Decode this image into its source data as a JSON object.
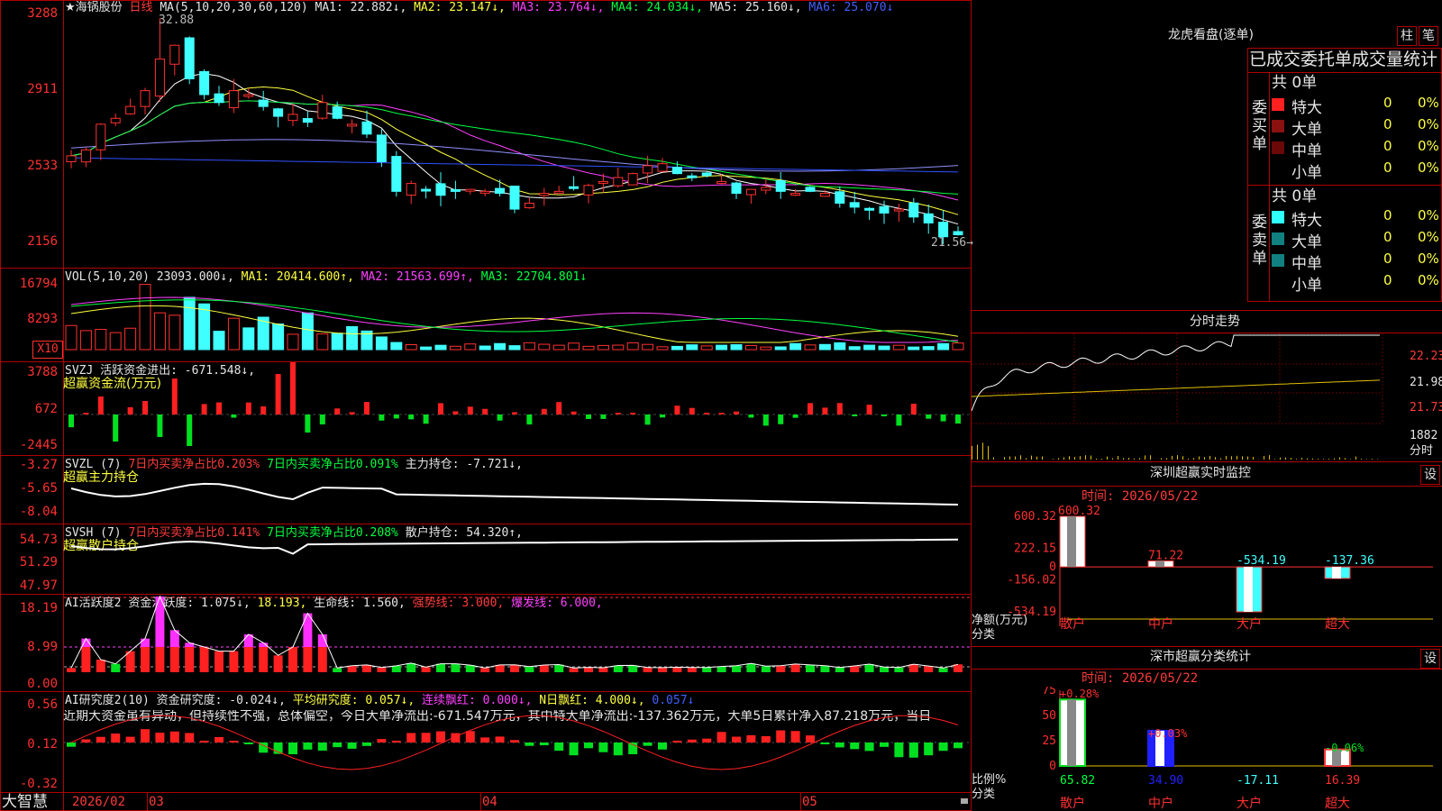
{
  "stock": {
    "name": "★海锅股份",
    "period": "日线",
    "ma_title": "MA(5,10,20,30,60,120)",
    "ma1": "MA1: 22.882↓,",
    "ma2": "MA2: 23.147↓,",
    "ma3": "MA3: 23.764↓,",
    "ma4": "MA4: 24.034↓,",
    "ma5": "MA5: 25.160↓,",
    "ma6": "MA6: 25.070↓",
    "high_mark": "32.88",
    "low_mark": "21.56→"
  },
  "price_axis": [
    "3288",
    "2911",
    "2533",
    "2156"
  ],
  "vol": {
    "title": "VOL(5,10,20)",
    "val": "23093.000↓,",
    "ma1": "MA1: 20414.600↑,",
    "ma2": "MA2: 21563.699↑,",
    "ma3": "MA3: 22704.801↓",
    "axis": [
      "16794",
      "8293"
    ],
    "unit": "X10"
  },
  "svzj": {
    "title": "SVZJ  活跃资金进出: -671.548↓,",
    "sub": "超赢资金流(万元)",
    "axis": [
      "3788",
      "672",
      "-2445"
    ]
  },
  "svzl": {
    "title": "SVZL (7)",
    "a": "7日内买卖净占比0.203%",
    "b": "7日内买卖净占比0.091%",
    "c": "主力持仓: -7.721↓,",
    "sub": "超赢主力持仓",
    "axis": [
      "-3.27",
      "-5.65",
      "-8.04"
    ]
  },
  "svsh": {
    "title": "SVSH (7)",
    "a": "7日内买卖净占比0.141%",
    "b": "7日内买卖净占比0.208%",
    "c": "散户持仓: 54.320↑,",
    "sub": "超赢散户持仓",
    "axis": [
      "54.73",
      "51.29",
      "47.97"
    ]
  },
  "ai1": {
    "title": "AI活跃度2",
    "a": "资金活跃度: 1.075↓,",
    "b": "18.193,",
    "c": "生命线: 1.560,",
    "d": "强势线: 3.000,",
    "e": "爆发线: 6.000,",
    "axis": [
      "18.19",
      "8.99",
      "0.00"
    ]
  },
  "ai2": {
    "title": "AI研究度2(10)",
    "a": "资金研究度: -0.024↓,",
    "b": "平均研究度: 0.057↓,",
    "c": "连续飘红: 0.000↓,",
    "d": "N日飘红: 4.000↓,",
    "e": "0.057↓",
    "axis": [
      "0.56",
      "0.12",
      "-0.32"
    ],
    "comment": "近期大资金虽有异动，但持续性不强，总体偏空，今日大单净流出:-671.547万元，其中特大单净流出:-137.362万元，大单5日累计净入87.218万元，当日"
  },
  "bottom_axis": {
    "brand": "大智慧",
    "labels": [
      "2026/02",
      "03",
      "04",
      "05"
    ]
  },
  "right": {
    "lhb_title": "龙虎看盘(逐单)",
    "btn_zhu": "柱",
    "btn_bi": "笔",
    "stats_title": "已成交委托单成交量统计",
    "buy_label": "委买单",
    "sell_label": "委卖单",
    "buy_total": "共 0单",
    "sell_total": "共 0单",
    "rows": [
      {
        "name": "特大",
        "val": "0",
        "pct": "0%"
      },
      {
        "name": "大单",
        "val": "0",
        "pct": "0%"
      },
      {
        "name": "中单",
        "val": "0",
        "pct": "0%"
      },
      {
        "name": "小单",
        "val": "0",
        "pct": "0%"
      }
    ],
    "fenshi_title": "分时走势",
    "fenshi_axis": [
      "22.23",
      "21.98",
      "21.73"
    ],
    "fenshi_vol": "1882",
    "fenshi_unit": "分时",
    "sz_title": "深圳超赢实时监控",
    "sz_btn": "设",
    "sz_time": "时间: 2026/05/22",
    "sz_axis": [
      "600.32",
      "222.15",
      "0",
      "-156.02",
      "-534.19"
    ],
    "sz_vals": [
      "600.32",
      "71.22",
      "-534.19",
      "-137.36"
    ],
    "sz_ylabel": "净额(万元)",
    "sz_xlabel": "分类",
    "cats": [
      "散户",
      "中户",
      "大户",
      "超大"
    ],
    "sm_title": "深市超赢分类统计",
    "sm_btn": "设",
    "sm_time": "时间: 2026/05/22",
    "sm_axis": [
      "75",
      "50",
      "25",
      "0"
    ],
    "sm_pcts": [
      "+0.28%",
      "+0.03%",
      "-0.06%"
    ],
    "sm_vals": [
      "65.82",
      "34.90",
      "-17.11",
      "16.39"
    ],
    "sm_ylabel": "比例%",
    "sm_xlabel": "分类"
  },
  "chart_data": {
    "type": "bar",
    "title": "深圳超赢实时监控",
    "categories": [
      "散户",
      "中户",
      "大户",
      "超大"
    ],
    "values": [
      600.32,
      71.22,
      -534.19,
      -137.36
    ],
    "ylabel": "净额(万元)",
    "ylim": [
      -534.19,
      600.32
    ]
  }
}
